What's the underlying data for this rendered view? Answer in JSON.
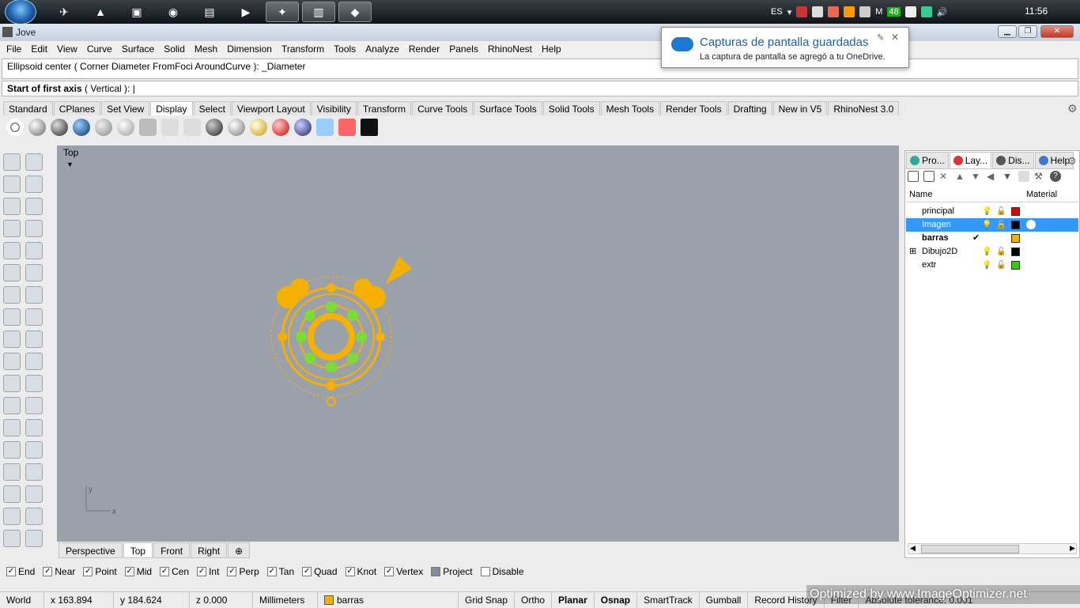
{
  "window": {
    "title": "Jove"
  },
  "taskbar": {
    "lang": "ES",
    "time": "11:56",
    "badge": "48",
    "tray_m": "M"
  },
  "menu": [
    "File",
    "Edit",
    "View",
    "Curve",
    "Surface",
    "Solid",
    "Mesh",
    "Dimension",
    "Transform",
    "Tools",
    "Analyze",
    "Render",
    "Panels",
    "RhinoNest",
    "Help"
  ],
  "command": {
    "history": "Ellipsoid center ( Corner  Diameter  FromFoci  AroundCurve ): _Diameter",
    "prompt_bold": "Start of first axis",
    "prompt_rest": " ( Vertical ): "
  },
  "toolbar_tabs": [
    "Standard",
    "CPlanes",
    "Set View",
    "Display",
    "Select",
    "Viewport Layout",
    "Visibility",
    "Transform",
    "Curve Tools",
    "Surface Tools",
    "Solid Tools",
    "Mesh Tools",
    "Render Tools",
    "Drafting",
    "New in V5",
    "RhinoNest 3.0"
  ],
  "active_toolbar_tab": "Display",
  "viewport": {
    "label": "Top",
    "axis_y": "y",
    "axis_x": "x"
  },
  "viewport_tabs": [
    "Perspective",
    "Top",
    "Front",
    "Right"
  ],
  "osnaps": [
    {
      "label": "End",
      "checked": true
    },
    {
      "label": "Near",
      "checked": true
    },
    {
      "label": "Point",
      "checked": true
    },
    {
      "label": "Mid",
      "checked": true
    },
    {
      "label": "Cen",
      "checked": true
    },
    {
      "label": "Int",
      "checked": true
    },
    {
      "label": "Perp",
      "checked": true
    },
    {
      "label": "Tan",
      "checked": true
    },
    {
      "label": "Quad",
      "checked": true
    },
    {
      "label": "Knot",
      "checked": true
    },
    {
      "label": "Vertex",
      "checked": true
    },
    {
      "label": "Project",
      "checked": false
    },
    {
      "label": "Disable",
      "checked": false
    }
  ],
  "status": {
    "world": "World",
    "x": "x 163.894",
    "y": "y 184.624",
    "z": "z 0.000",
    "units": "Millimeters",
    "layer": "barras",
    "grid": "Grid Snap",
    "ortho": "Ortho",
    "planar": "Planar",
    "osnap": "Osnap",
    "smarttrack": "SmartTrack",
    "gumball": "Gumball",
    "history": "Record History",
    "filter": "Filter",
    "tolerance": "Absolute tolerance: 0.001"
  },
  "panel": {
    "tabs": [
      "Pro...",
      "Lay...",
      "Dis...",
      "Help"
    ],
    "col_name": "Name",
    "col_material": "Material",
    "layers": [
      {
        "name": "principal",
        "color": "#e00000"
      },
      {
        "name": "Imagen",
        "color": "#000000"
      },
      {
        "name": "barras",
        "color": "#f5b000",
        "current": "✔"
      },
      {
        "name": "Dibujo2D",
        "color": "#000000",
        "expand": "⊞"
      },
      {
        "name": "extr",
        "color": "#33cc00"
      }
    ]
  },
  "toast": {
    "title": "Capturas de pantalla guardadas",
    "body": "La captura de pantalla se agregó a tu OneDrive."
  },
  "watermark": "Optimized by www.ImageOptimizer.net"
}
